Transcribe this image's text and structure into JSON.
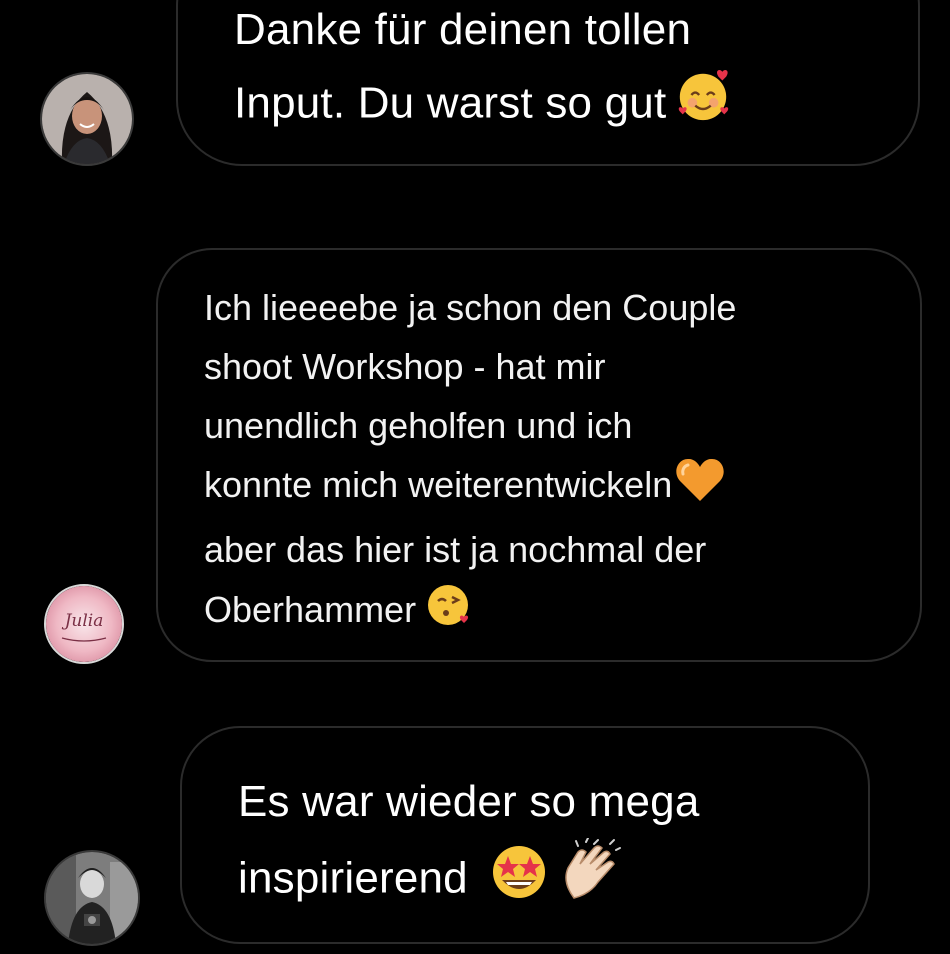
{
  "messages": [
    {
      "avatar_icon": "avatar-woman-dark-hair-photo",
      "text": "Danke für deinen tollen\nInput. Du warst so gut",
      "emojis": [
        "smiling-face-with-hearts"
      ]
    },
    {
      "avatar_icon": "avatar-julia-logo",
      "avatar_text": "Julia",
      "text": "Ich lieeeebe ja schon den Couple\nshoot Workshop - hat mir\nunendlich geholfen und ich\nkonnte mich weiterentwickeln",
      "text2": "aber das hier ist ja nochmal der\nOberhammer",
      "emojis": [
        "orange-heart",
        "face-blowing-kiss"
      ]
    },
    {
      "avatar_icon": "avatar-person-bw-photo",
      "text": "Es war wieder so mega\ninspirierend",
      "emojis": [
        "star-struck",
        "clapping-hands"
      ]
    }
  ],
  "colors": {
    "background": "#000000",
    "bubble_border": "#2b2b2b",
    "text": "#ffffff"
  }
}
